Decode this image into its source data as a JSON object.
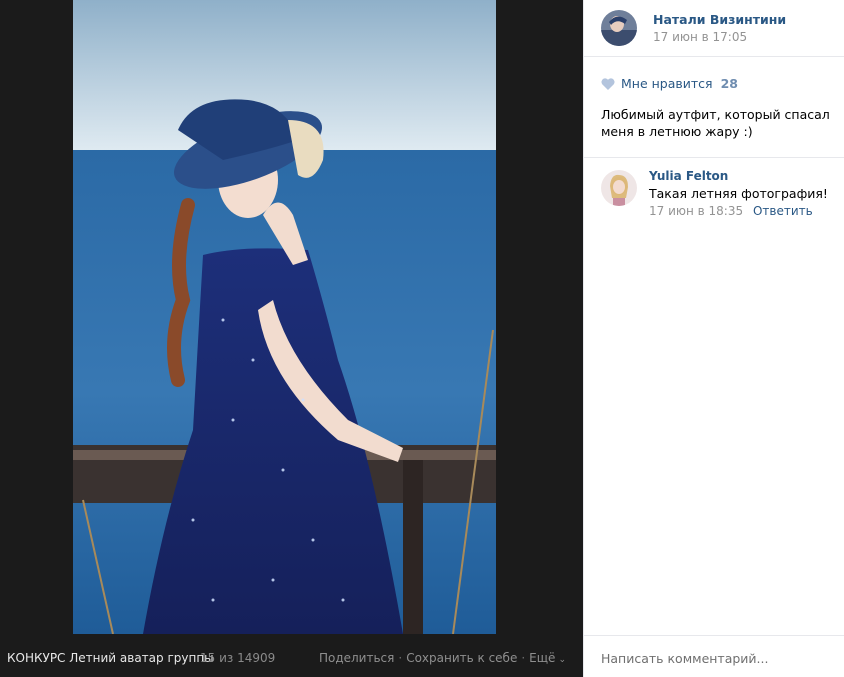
{
  "viewer": {
    "album": "КОНКУРС Летний аватар группы",
    "counter": "15 из 14909",
    "actions": {
      "share": "Поделиться",
      "save": "Сохранить к себе",
      "more": "Ещё",
      "separator": "·"
    },
    "photo_icon": "photo-girl-sea"
  },
  "post": {
    "author_name": "Натали Визинтини",
    "date": "17 июн в 17:05",
    "like_label": "Мне нравится",
    "like_count": "28",
    "caption": "Любимый аутфит, который спасал меня в летнюю жару :)"
  },
  "comments": [
    {
      "name": "Yulia Felton",
      "text": "Такая летняя фотография!",
      "date": "17 июн в 18:35",
      "reply_label": "Ответить"
    }
  ],
  "composer": {
    "placeholder": "Написать комментарий..."
  },
  "colors": {
    "link": "#2a5885",
    "viewer_bg": "#1b1b1b",
    "heart": "#b3c4dd"
  }
}
